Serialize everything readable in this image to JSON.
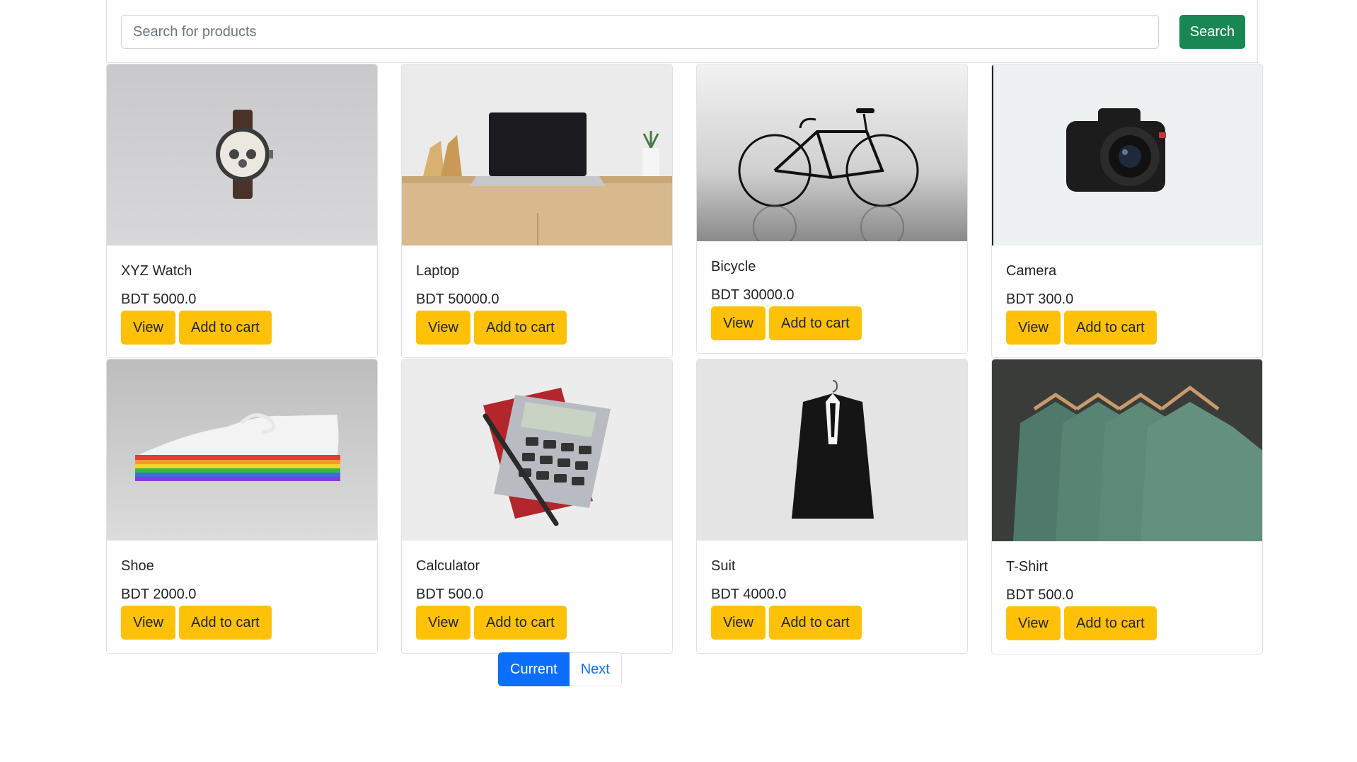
{
  "search": {
    "placeholder": "Search for products",
    "button_label": "Search"
  },
  "products": [
    {
      "name": "XYZ Watch",
      "price": "BDT 5000.0",
      "image": "watch"
    },
    {
      "name": "Laptop",
      "price": "BDT 50000.0",
      "image": "laptop"
    },
    {
      "name": "Bicycle",
      "price": "BDT 30000.0",
      "image": "bicycle"
    },
    {
      "name": "Camera",
      "price": "BDT 300.0",
      "image": "camera"
    },
    {
      "name": "Shoe",
      "price": "BDT 2000.0",
      "image": "shoe"
    },
    {
      "name": "Calculator",
      "price": "BDT 500.0",
      "image": "calculator"
    },
    {
      "name": "Suit",
      "price": "BDT 4000.0",
      "image": "suit"
    },
    {
      "name": "T-Shirt",
      "price": "BDT 500.0",
      "image": "t-shirt"
    }
  ],
  "card_actions": {
    "view_label": "View",
    "add_label": "Add to cart"
  },
  "pagination": {
    "current_label": "Current",
    "next_label": "Next"
  },
  "colors": {
    "search_button": "#198754",
    "action_button": "#ffc107",
    "page_current": "#0d6efd"
  }
}
